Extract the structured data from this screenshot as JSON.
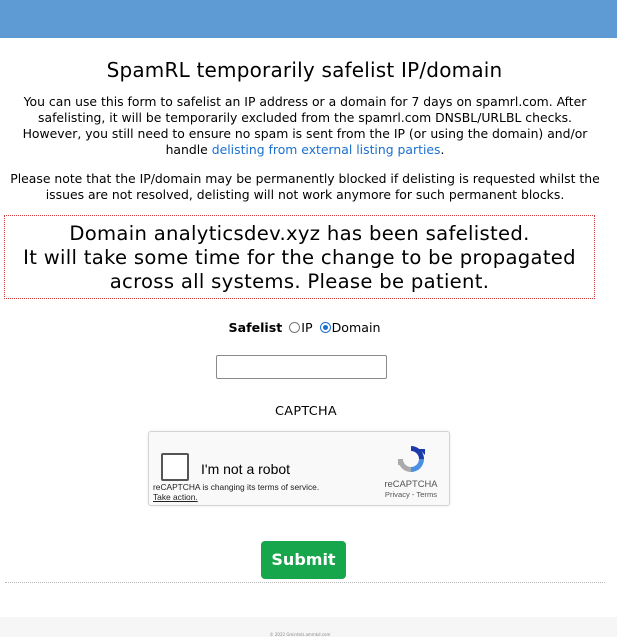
{
  "page": {
    "title": "SpamRL temporarily safelist IP/domain",
    "intro_text": "You can use this form to safelist an IP address or a domain for 7 days on spamrl.com. After safelisting, it will be temporarily excluded from the spamrl.com DNSBL/URLBL checks. However, you still need to ensure no spam is sent from the IP (or using the domain) and/or handle ",
    "intro_link": "delisting from external listing parties",
    "intro_end": ".",
    "note": "Please note that the IP/domain may be permanently blocked if delisting is requested whilst the issues are not resolved, delisting will not work anymore for such permanent blocks."
  },
  "result": {
    "line1": "Domain analyticsdev.xyz has been safelisted.",
    "line2": "It will take some time for the change to be propagated across all systems. Please be patient."
  },
  "form": {
    "safelist_label": "Safelist",
    "option_ip": "IP",
    "option_domain": "Domain",
    "selected": "Domain",
    "input_value": "",
    "captcha_label": "CAPTCHA",
    "submit_label": "Submit"
  },
  "recaptcha": {
    "label": "I'm not a robot",
    "notice": "reCAPTCHA is changing its terms of service.",
    "notice_link": "Take action.",
    "brand": "reCAPTCHA",
    "links": "Privacy - Terms"
  },
  "footer": {
    "text": "© 2022 Gmintelz.ammkd.com"
  },
  "colors": {
    "top_bar": "#5e9bd5",
    "link": "#1a6fd1",
    "result_border": "#d23c3c",
    "submit": "#17a64b"
  }
}
